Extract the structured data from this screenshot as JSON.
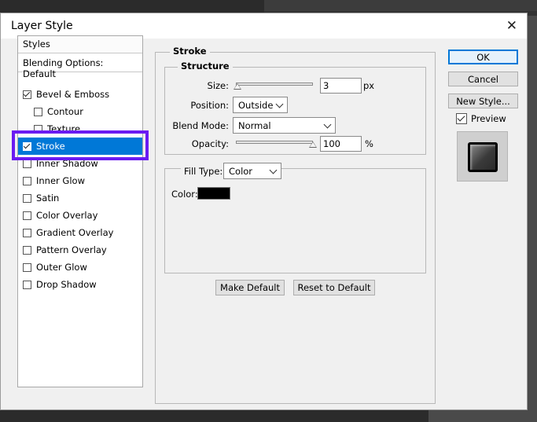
{
  "dialog": {
    "title": "Layer Style",
    "close": "✕"
  },
  "styles_list": {
    "header": "Styles",
    "blending": "Blending Options: Default",
    "items": [
      {
        "label": "Bevel & Emboss",
        "checked": true
      },
      {
        "label": "Contour",
        "checked": false
      },
      {
        "label": "Texture",
        "checked": false
      },
      {
        "label": "Stroke",
        "checked": true
      },
      {
        "label": "Inner Shadow",
        "checked": false
      },
      {
        "label": "Inner Glow",
        "checked": false
      },
      {
        "label": "Satin",
        "checked": false
      },
      {
        "label": "Color Overlay",
        "checked": false
      },
      {
        "label": "Gradient Overlay",
        "checked": false
      },
      {
        "label": "Pattern Overlay",
        "checked": false
      },
      {
        "label": "Outer Glow",
        "checked": false
      },
      {
        "label": "Drop Shadow",
        "checked": false
      }
    ]
  },
  "stroke": {
    "title": "Stroke",
    "structure": {
      "title": "Structure",
      "size_label": "Size:",
      "size_value": "3",
      "size_unit": "px",
      "position_label": "Position:",
      "position_value": "Outside",
      "blend_label": "Blend Mode:",
      "blend_value": "Normal",
      "opacity_label": "Opacity:",
      "opacity_value": "100",
      "opacity_unit": "%"
    },
    "fill": {
      "type_label": "Fill Type:",
      "type_value": "Color",
      "color_label": "Color:",
      "color_hex": "#000000"
    },
    "make_default": "Make Default",
    "reset_default": "Reset to Default"
  },
  "buttons": {
    "ok": "OK",
    "cancel": "Cancel",
    "new_style": "New Style...",
    "preview": "Preview",
    "preview_checked": true
  },
  "colors": {
    "selection": "#0078d7",
    "highlight_box": "#6a1bf2"
  }
}
